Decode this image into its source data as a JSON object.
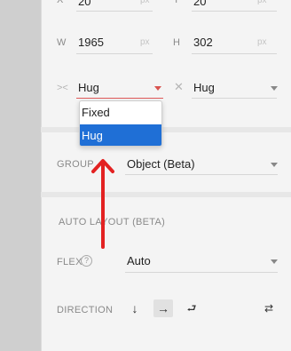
{
  "position": {
    "x_label": "X",
    "x_value": "20",
    "x_unit": "px",
    "y_label": "Y",
    "y_value": "20",
    "y_unit": "px"
  },
  "size": {
    "w_label": "W",
    "w_value": "1965",
    "w_unit": "px",
    "h_label": "H",
    "h_value": "302",
    "h_unit": "px"
  },
  "sizing": {
    "horizontal_value": "Hug",
    "vertical_value": "Hug",
    "dropdown_options": [
      {
        "label": "Fixed",
        "selected": false
      },
      {
        "label": "Hug",
        "selected": true
      }
    ]
  },
  "group": {
    "label": "GROUP",
    "value": "Object (Beta)"
  },
  "auto_layout": {
    "section_title": "AUTO LAYOUT (BETA)",
    "flex_label": "FLEX",
    "help_icon": "?",
    "flex_value": "Auto",
    "direction_label": "DIRECTION",
    "direction_buttons": [
      {
        "name": "down",
        "glyph": "↓",
        "active": false
      },
      {
        "name": "right",
        "glyph": "→",
        "active": true
      },
      {
        "name": "wrap",
        "glyph": "⮐",
        "active": false
      },
      {
        "name": "swap",
        "glyph": "⇄",
        "active": false
      }
    ]
  },
  "colors": {
    "accent_blue": "#1f6fd6",
    "annotation_red": "#e32222"
  }
}
